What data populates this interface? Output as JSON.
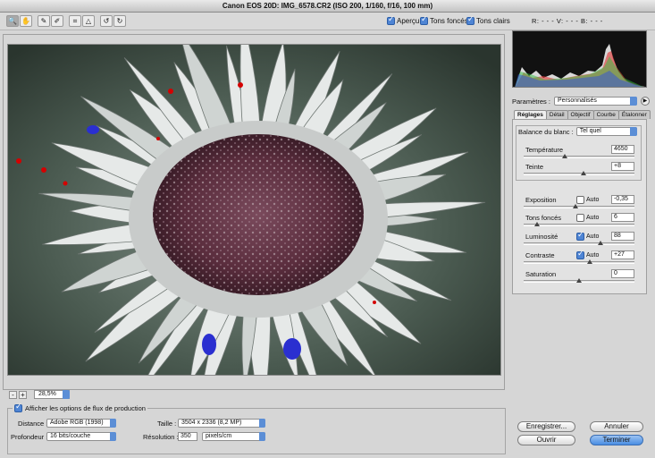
{
  "window": {
    "title": "Canon EOS 20D:  IMG_6578.CR2  (ISO 200, 1/160, f/16, 100 mm)"
  },
  "toolbar": {
    "tools": [
      "zoom-tool",
      "hand-tool",
      "white-balance-tool",
      "color-sampler-tool",
      "crop-tool",
      "straighten-tool",
      "rotate-left-tool",
      "rotate-right-tool"
    ],
    "apercu": "Aperçu",
    "tons_fonces": "Tons foncés",
    "tons_clairs": "Tons clairs",
    "rgb": "R: - - -   V: - - -   B: - - -"
  },
  "preview": {
    "zoom": "28,5%",
    "zoom_out": "-",
    "zoom_in": "+"
  },
  "params": {
    "label": "Paramètres :",
    "value": "Personnalisés"
  },
  "tabs": [
    "Réglages",
    "Détail",
    "Objectif",
    "Courbe",
    "Étalonner"
  ],
  "white_balance": {
    "label": "Balance du blanc :",
    "value": "Tel quel"
  },
  "adjust": {
    "temperature": {
      "label": "Température",
      "value": "4650",
      "level": 0.37
    },
    "teinte": {
      "label": "Teinte",
      "value": "+8",
      "level": 0.54
    },
    "exposition": {
      "label": "Exposition",
      "value": "-0,35",
      "auto": "Auto",
      "auto_on": false,
      "level": 0.47
    },
    "tons_fonces": {
      "label": "Tons foncés",
      "value": "6",
      "auto": "Auto",
      "auto_on": false,
      "level": 0.12
    },
    "luminosite": {
      "label": "Luminosité",
      "value": "88",
      "auto": "Auto",
      "auto_on": true,
      "level": 0.69
    },
    "contraste": {
      "label": "Contraste",
      "value": "+27",
      "auto": "Auto",
      "auto_on": true,
      "level": 0.6
    },
    "saturation": {
      "label": "Saturation",
      "value": "0",
      "level": 0.5
    }
  },
  "workflow": {
    "toggle": "Afficher les options de flux de production",
    "distance_label": "Distance :",
    "distance_value": "Adobe RGB (1998)",
    "profondeur_label": "Profondeur :",
    "profondeur_value": "16 bits/couche",
    "taille_label": "Taille :",
    "taille_value": "3504 x 2336 (8,2 MP)",
    "resolution_label": "Résolution :",
    "resolution_value": "350",
    "resolution_unit": "pixels/cm"
  },
  "buttons": {
    "enregistrer": "Enregistrer...",
    "ouvrir": "Ouvrir",
    "annuler": "Annuler",
    "terminer": "Terminer"
  }
}
